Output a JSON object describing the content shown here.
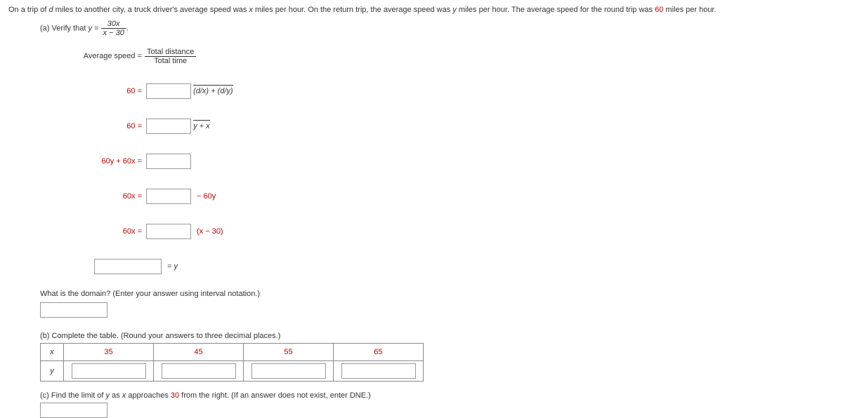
{
  "problem": {
    "prefix": "On a trip of ",
    "d": "d",
    "mid1": " miles to another city, a truck driver's average speed was ",
    "x": "x",
    "mid2": " miles per hour. On the return trip, the average speed was ",
    "y": "y",
    "mid3": " miles per hour. The average speed for the round trip was ",
    "sixty": "60",
    "suffix": " miles per hour."
  },
  "partA": {
    "label": "(a) Verify that ",
    "eq_lhs": "y = ",
    "frac_num": "30x",
    "frac_den": "x − 30",
    "avg_label": "Average speed = ",
    "avg_num": "Total distance",
    "avg_den": "Total time",
    "row1_label": "60 =",
    "row1_den": "(d/x) + (d/y)",
    "row2_label": "60 =",
    "row2_den": "y + x",
    "row3_label": "60y + 60x =",
    "row4_label": "60x =",
    "row4_rhs": "− 60y",
    "row5_label": "60x =",
    "row5_rhs": "(x − 30)",
    "row6_rhs": "= y"
  },
  "domain": {
    "question": "What is the domain? (Enter your answer using interval notation.)"
  },
  "partB": {
    "label": "(b) Complete the table. (Round your answers to three decimal places.)",
    "row_x": "x",
    "row_y": "y",
    "cols": [
      "35",
      "45",
      "55",
      "65"
    ]
  },
  "partC": {
    "prefix": "(c) Find the limit of ",
    "y": "y",
    "mid1": " as ",
    "x": "x",
    "mid2": " approaches ",
    "thirty": "30",
    "suffix": " from the right. (If an answer does not exist, enter DNE.)"
  }
}
